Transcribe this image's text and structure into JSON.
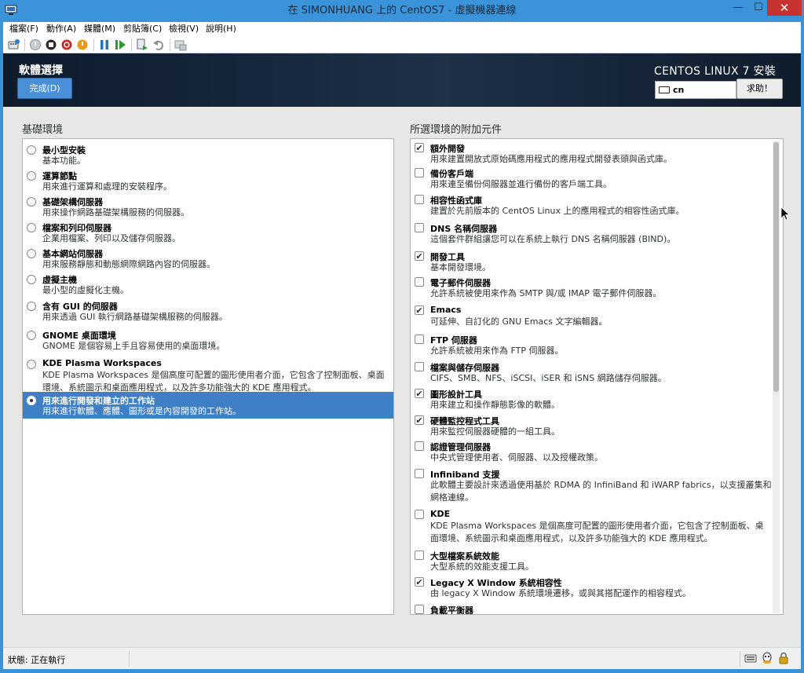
{
  "window": {
    "title": "在 SIMONHUANG 上的 CentOS7 - 虛擬機器連線",
    "minimize_glyph": "—",
    "maximize_glyph": "☐",
    "close_glyph": "✕"
  },
  "menu": [
    "檔案(F)",
    "動作(A)",
    "媒體(M)",
    "剪貼簿(C)",
    "檢視(V)",
    "說明(H)"
  ],
  "toolbar_icons": [
    "ctrl-alt-del-icon",
    "start-icon",
    "turn-off-icon",
    "shutdown-icon",
    "power-icon",
    "pause-icon",
    "resume-icon",
    "checkpoint-icon",
    "revert-icon",
    "enhanced-session-icon"
  ],
  "installer": {
    "page_title": "軟體選擇",
    "done_label": "完成(D)",
    "product_title": "CENTOS LINUX 7 安裝",
    "keyboard_layout": "cn",
    "help_label": "求助！"
  },
  "base_env": {
    "title": "基礎環境",
    "items": [
      {
        "name": "最小型安裝",
        "desc": "基本功能。",
        "selected": false
      },
      {
        "name": "運算節點",
        "desc": "用來進行運算和處理的安裝程序。",
        "selected": false
      },
      {
        "name": "基礎架構伺服器",
        "desc": "用來操作網路基礎架構服務的伺服器。",
        "selected": false
      },
      {
        "name": "檔案和列印伺服器",
        "desc": "企業用檔案、列印以及儲存伺服器。",
        "selected": false
      },
      {
        "name": "基本網站伺服器",
        "desc": "用來服務靜態和動態網際網路內容的伺服器。",
        "selected": false
      },
      {
        "name": "虛擬主機",
        "desc": "最小型的虛擬化主機。",
        "selected": false
      },
      {
        "name": "含有 GUI 的伺服器",
        "desc": "用來透過 GUI 執行網路基礎架構服務的伺服器。",
        "selected": false
      },
      {
        "name": "GNOME 桌面環境",
        "desc": "GNOME 是個容易上手且容易使用的桌面環境。",
        "selected": false
      },
      {
        "name": "KDE Plasma Workspaces",
        "desc": "KDE Plasma Workspaces 是個高度可配置的圖形使用者介面，它包含了控制面板、桌面環境、系統圖示和桌面應用程式，以及許多功能強大的 KDE 應用程式。",
        "selected": false
      },
      {
        "name": "用來進行開發和建立的工作站",
        "desc": "用來進行軟體、應體、圖形或是內容開發的工作站。",
        "selected": true
      }
    ]
  },
  "addons": {
    "title": "所選環境的附加元件",
    "items": [
      {
        "name": "額外開發",
        "desc": "用來建置開放式原始碼應用程式的應用程式開發表頭與函式庫。",
        "checked": true
      },
      {
        "name": "備份客戶端",
        "desc": "用來連至備份伺服器並進行備份的客戶端工具。",
        "checked": false
      },
      {
        "name": "相容性函式庫",
        "desc": "建置於先前版本的 CentOS Linux 上的應用程式的相容性函式庫。",
        "checked": false
      },
      {
        "name": "DNS 名稱伺服器",
        "desc": "這個套件群組讓您可以在系統上執行 DNS 名稱伺服器 (BIND)。",
        "checked": false
      },
      {
        "name": "開發工具",
        "desc": "基本開發環境。",
        "checked": true
      },
      {
        "name": "電子郵件伺服器",
        "desc": "允許系統被使用來作為 SMTP 與/或 IMAP 電子郵件伺服器。",
        "checked": false
      },
      {
        "name": "Emacs",
        "desc": "可延伸、自訂化的 GNU Emacs 文字編輯器。",
        "checked": true
      },
      {
        "name": "FTP 伺服器",
        "desc": "允許系統被用來作為 FTP 伺服器。",
        "checked": false
      },
      {
        "name": "檔案與儲存伺服器",
        "desc": "CIFS、SMB、NFS、iSCSI、iSER 和 iSNS 網路儲存伺服器。",
        "checked": false
      },
      {
        "name": "圖形設計工具",
        "desc": "用來建立和操作靜態影像的軟體。",
        "checked": true
      },
      {
        "name": "硬體監控程式工具",
        "desc": "用來監控伺服器硬體的一組工具。",
        "checked": true
      },
      {
        "name": "認證管理伺服器",
        "desc": "中央式管理使用者、伺服器、以及授權政策。",
        "checked": false
      },
      {
        "name": "Infiniband 支援",
        "desc": "此軟體主要設計來透過使用基於 RDMA 的 InfiniBand 和 iWARP fabrics，以支援叢集和網格連線。",
        "checked": false
      },
      {
        "name": "KDE",
        "desc": "KDE Plasma Workspaces 是個高度可配置的圖形使用者介面，它包含了控制面板、桌面環境、系統圖示和桌面應用程式，以及許多功能強大的 KDE 應用程式。",
        "checked": false
      },
      {
        "name": "大型檔案系統效能",
        "desc": "大型系統的效能支援工具。",
        "checked": false
      },
      {
        "name": "Legacy X Window 系統相容性",
        "desc": "由 legacy X Window 系統環境遷移，或與其搭配運作的相容程式。",
        "checked": true
      },
      {
        "name": "負載平衡器",
        "desc": "",
        "checked": false
      }
    ]
  },
  "status": {
    "text": "狀態: 正在執行"
  }
}
